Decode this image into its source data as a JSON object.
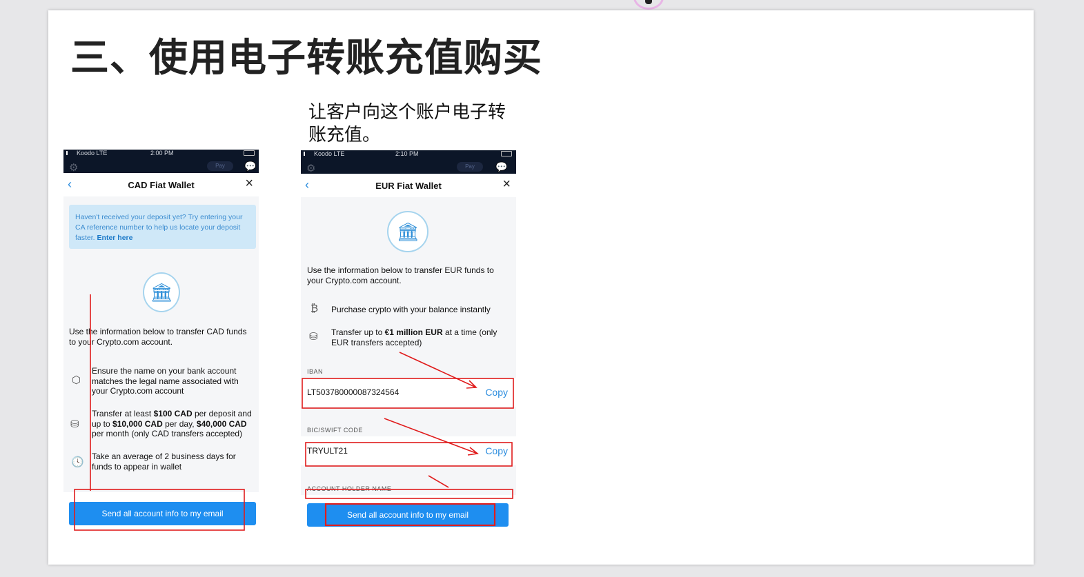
{
  "slide": {
    "title": "三、使用电子转账充值购买",
    "caption": "让客户向这个账户电子转账充值。"
  },
  "colors": {
    "accent": "#1e8ef0",
    "annotation": "#e01c1c",
    "status_bar": "#0c1628"
  },
  "phone_cad": {
    "status": {
      "carrier": "Koodo  LTE",
      "time": "2:00 PM",
      "pay": "Pay"
    },
    "nav_title": "CAD Fiat Wallet",
    "notice": {
      "text": "Haven't received your deposit yet? Try entering your CA reference number to help us locate your deposit faster.",
      "link": "Enter here"
    },
    "intro": "Use the information below to transfer CAD funds to your Crypto.com account.",
    "features": [
      {
        "icon": "shield-icon",
        "parts": [
          {
            "t": "Ensure the name on your bank account matches the legal name associated with your Crypto.com account"
          }
        ]
      },
      {
        "icon": "coins-icon",
        "parts": [
          {
            "t": "Transfer at least "
          },
          {
            "b": "$100 CAD"
          },
          {
            "t": " per deposit and up to "
          },
          {
            "b": "$10,000 CAD"
          },
          {
            "t": " per day, "
          },
          {
            "b": "$40,000 CAD"
          },
          {
            "t": " per month (only CAD transfers accepted)"
          }
        ]
      },
      {
        "icon": "clock-icon",
        "parts": [
          {
            "t": "Take an average of 2 business days for funds to appear in wallet"
          }
        ]
      }
    ],
    "button": "Send all account info to my email"
  },
  "phone_eur": {
    "status": {
      "carrier": "Koodo  LTE",
      "time": "2:10 PM",
      "pay": "Pay"
    },
    "nav_title": "EUR Fiat Wallet",
    "intro": "Use the information below to transfer EUR funds to your Crypto.com account.",
    "features": [
      {
        "icon": "bitcoin-icon",
        "parts": [
          {
            "t": "Purchase crypto with your balance instantly"
          }
        ]
      },
      {
        "icon": "coins-icon",
        "parts": [
          {
            "t": "Transfer up to "
          },
          {
            "b": "€1 million EUR"
          },
          {
            "t": " at a time (only EUR transfers accepted)"
          }
        ]
      }
    ],
    "iban": {
      "label": "IBAN",
      "value": "LT503780000087324564",
      "copy": "Copy"
    },
    "bic": {
      "label": "BIC/SWIFT CODE",
      "value": "TRYULT21",
      "copy": "Copy"
    },
    "holder": {
      "label": "ACCOUNT HOLDER NAME"
    },
    "button": "Send all account info to my email"
  }
}
